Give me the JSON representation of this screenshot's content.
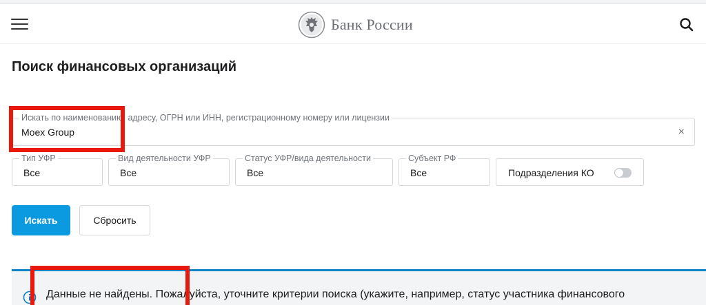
{
  "header": {
    "brand_name": "Банк России",
    "menu_icon": "hamburger-icon",
    "search_icon": "search-icon"
  },
  "page": {
    "title": "Поиск финансовых организаций"
  },
  "search": {
    "label": "Искать по наименованию, адресу, ОГРН или ИНН, регистрационному номеру или лицензии",
    "value": "Moex Group",
    "clear_symbol": "×"
  },
  "filters": [
    {
      "label": "Тип УФР",
      "value": "Все"
    },
    {
      "label": "Вид деятельности УФР",
      "value": "Все"
    },
    {
      "label": "Статус УФР/вида деятельности",
      "value": "Все"
    },
    {
      "label": "Субъект РФ",
      "value": "Все"
    }
  ],
  "toggle": {
    "label": "Подразделения КО",
    "enabled": false
  },
  "buttons": {
    "search": "Искать",
    "reset": "Сбросить"
  },
  "notice": {
    "text": "Данные не найдены. Пожалуйста, уточните критерии поиска (укажите, например, статус участника финансового"
  },
  "colors": {
    "primary": "#0b9ae0",
    "notice_border": "#0a84c7",
    "highlight": "#e8180c",
    "brand_text": "#6b6f75"
  }
}
